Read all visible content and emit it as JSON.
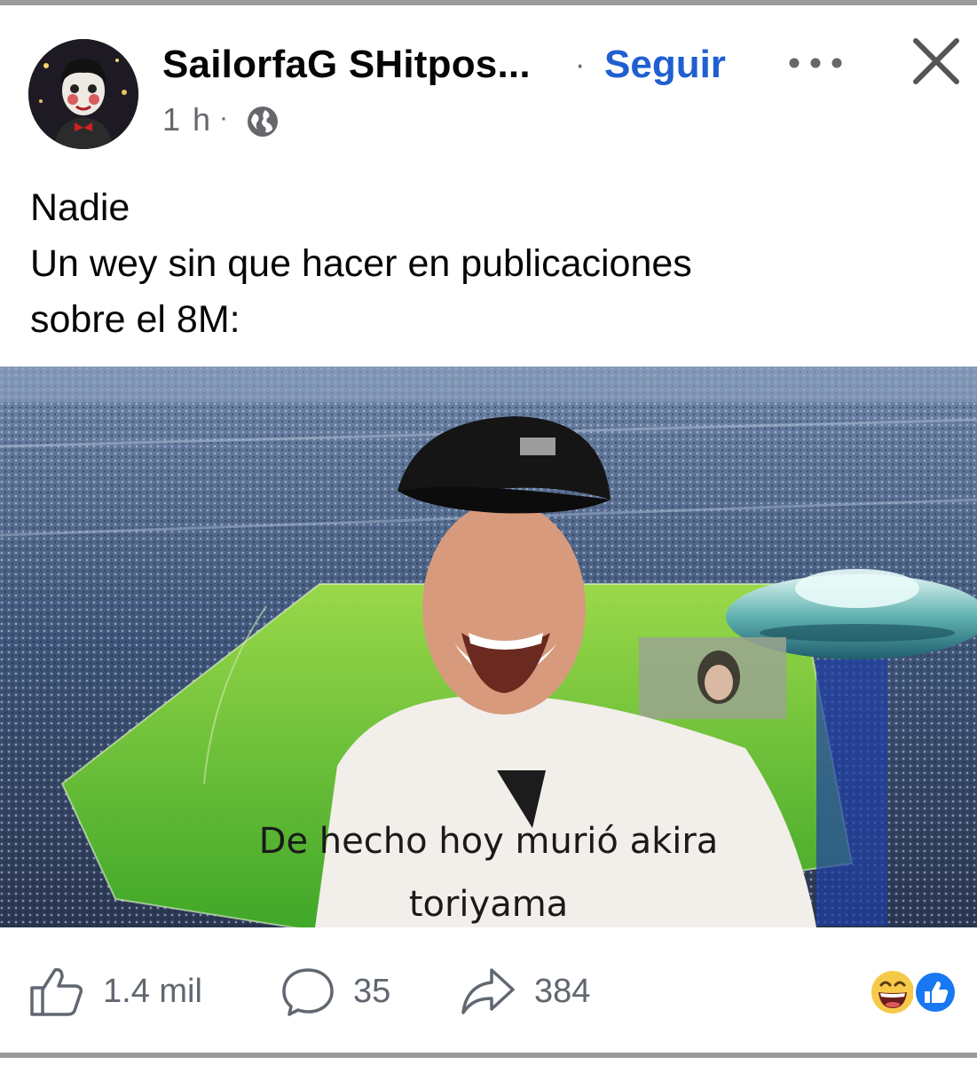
{
  "post": {
    "author": "SailorfaG SHitpos...",
    "separator": "·",
    "follow_label": "Seguir",
    "time": "1 h",
    "time_separator": "·",
    "privacy_icon": "globe-icon",
    "lines": [
      "Nadie",
      "Un wey sin que hacer en publicaciones",
      "sobre el 8M:"
    ]
  },
  "meme": {
    "caption_line1": "De hecho hoy murió akira",
    "caption_line2": "toriyama"
  },
  "actions": {
    "like_count": "1.4 mil",
    "comment_count": "35",
    "share_count": "384",
    "reaction_icons": [
      "laughing-emoji-icon",
      "like-reaction-icon"
    ]
  },
  "colors": {
    "accent": "#1f5fd1",
    "muted": "#65676b",
    "like_badge": "#1877f2"
  }
}
